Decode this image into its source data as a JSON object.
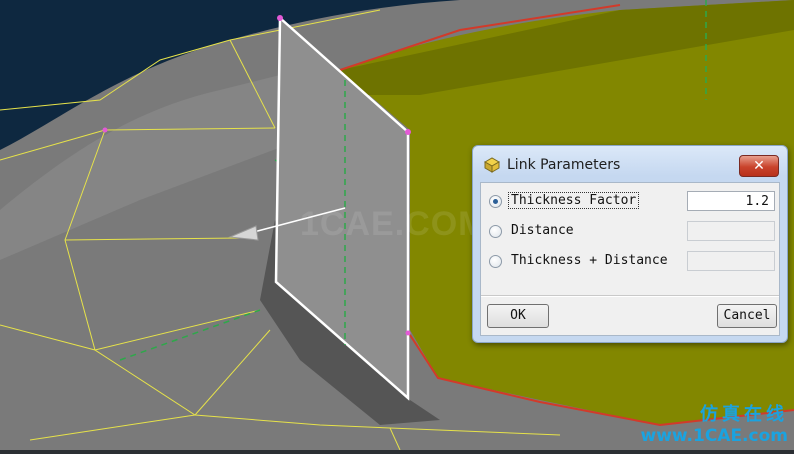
{
  "dialog": {
    "title": "Link Parameters",
    "title_icon": "link-icon",
    "close_label": "✕",
    "options": [
      {
        "label": "Thickness Factor",
        "value": "1.2",
        "selected": true,
        "field_enabled": true
      },
      {
        "label": "Distance",
        "value": "",
        "selected": false,
        "field_enabled": false
      },
      {
        "label": "Thickness + Distance",
        "value": "",
        "selected": false,
        "field_enabled": false
      }
    ],
    "ok_label": "OK",
    "cancel_label": "Cancel"
  },
  "watermark": {
    "text": "1CAE.COM"
  },
  "logo": {
    "cn": "仿真在线",
    "url": "www.1CAE.com"
  },
  "colors": {
    "surface_olive": "#828700",
    "surface_gray": "#7c7c7c",
    "mesh_line": "#e6e24a",
    "plane_fill": "#8f8f8f",
    "edge_red": "#d23a2a",
    "background_navy": "#0e2840",
    "logo_blue": "#1aa3e0"
  }
}
